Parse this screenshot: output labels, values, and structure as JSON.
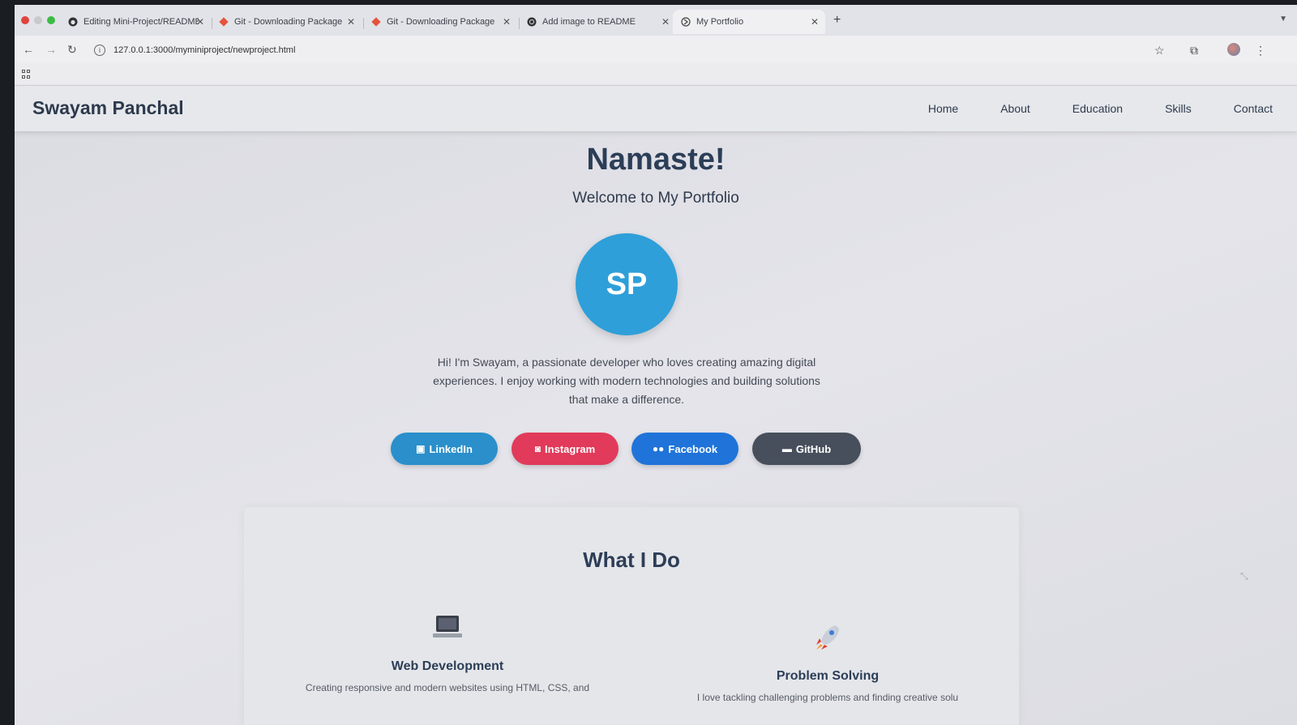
{
  "browser": {
    "tabs": [
      {
        "label": "Editing Mini-Project/README",
        "icon": "github-icon",
        "active": false
      },
      {
        "label": "Git - Downloading Package",
        "icon": "git-icon",
        "active": false
      },
      {
        "label": "Git - Downloading Package",
        "icon": "git-icon",
        "active": false
      },
      {
        "label": "Add image to README",
        "icon": "chatgpt-icon",
        "active": false
      },
      {
        "label": "My Portfolio",
        "icon": "page-icon",
        "active": true
      }
    ],
    "url": "127.0.0.1:3000/myminiproject/newproject.html"
  },
  "site": {
    "brand": "Swayam Panchal",
    "nav": [
      "Home",
      "About",
      "Education",
      "Skills",
      "Contact"
    ]
  },
  "hero": {
    "title": "Namaste!",
    "subtitle": "Welcome to My Portfolio",
    "avatar_initials": "SP",
    "bio": "Hi! I'm Swayam, a passionate developer who loves creating amazing digital experiences. I enjoy working with modern technologies and building solutions that make a difference."
  },
  "social": [
    {
      "label": "LinkedIn",
      "icon": "linkedin-icon",
      "color": "#2a8fcb"
    },
    {
      "label": "Instagram",
      "icon": "camera-icon",
      "color": "#e13a5a"
    },
    {
      "label": "Facebook",
      "icon": "people-icon",
      "color": "#1f73d9"
    },
    {
      "label": "GitHub",
      "icon": "laptop-icon",
      "color": "#474f5c"
    }
  ],
  "what_i_do": {
    "title": "What I Do",
    "features": [
      {
        "name": "Web Development",
        "icon": "laptop-icon",
        "desc": "Creating responsive and modern websites using HTML, CSS, and"
      },
      {
        "name": "Problem Solving",
        "icon": "rocket-icon",
        "desc": "I love tackling challenging problems and finding creative solu"
      }
    ]
  },
  "colors": {
    "accent": "#2e9fd9",
    "heading": "#2c3e57"
  }
}
